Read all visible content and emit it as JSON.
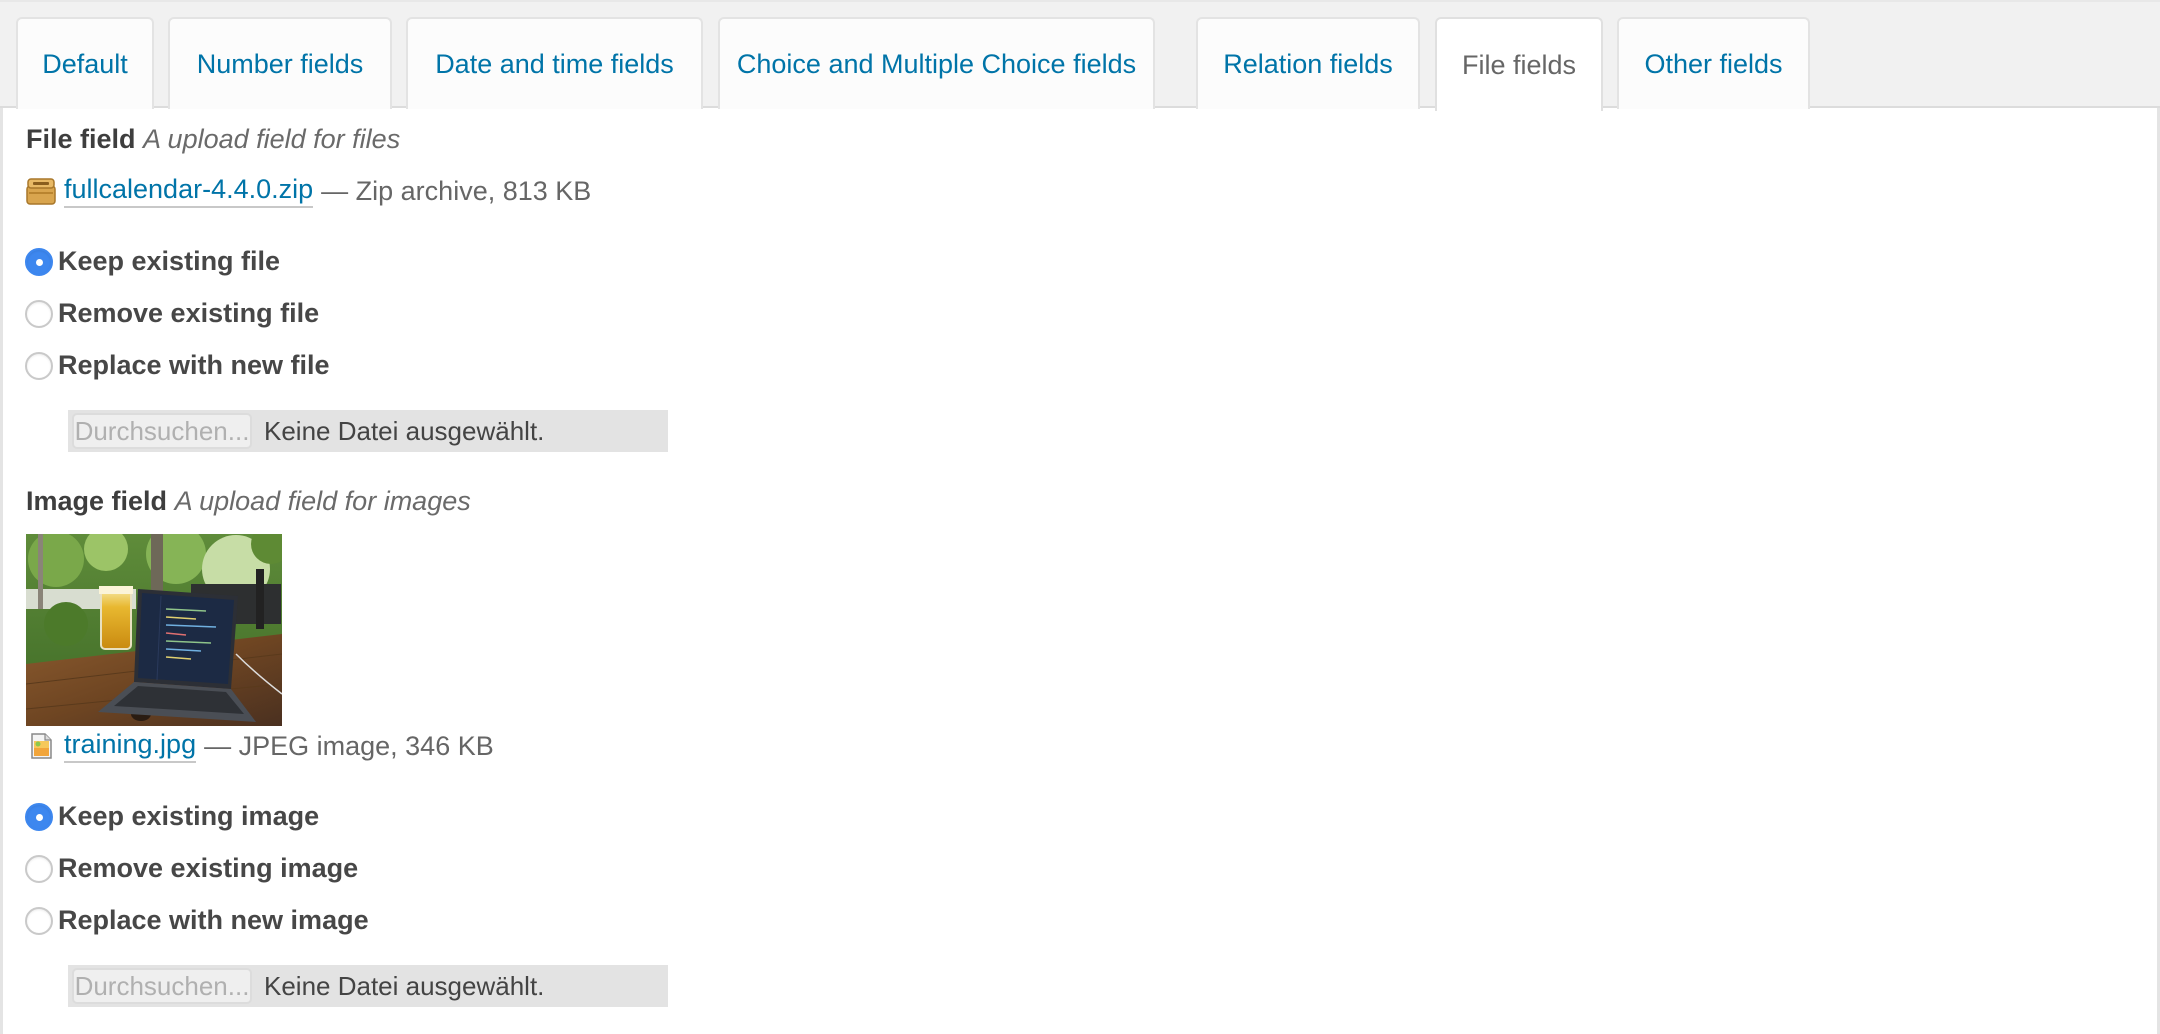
{
  "tabs": [
    {
      "label": "Default",
      "active": false
    },
    {
      "label": "Number fields",
      "active": false
    },
    {
      "label": "Date and time fields",
      "active": false
    },
    {
      "label": "Choice and Multiple Choice fields",
      "active": false
    },
    {
      "label": "Relation fields",
      "active": false
    },
    {
      "label": "File fields",
      "active": true
    },
    {
      "label": "Other fields",
      "active": false
    }
  ],
  "file_field": {
    "label": "File field",
    "help": "A upload field for files",
    "icon": "archive-icon",
    "filename": "fullcalendar-4.4.0.zip",
    "meta": "— Zip archive, 813 KB",
    "options": [
      {
        "label": "Keep existing file",
        "checked": true
      },
      {
        "label": "Remove existing file",
        "checked": false
      },
      {
        "label": "Replace with new file",
        "checked": false
      }
    ],
    "browse_label": "Durchsuchen...",
    "no_file_label": "Keine Datei ausgewählt."
  },
  "image_field": {
    "label": "Image field",
    "help": "A upload field for images",
    "thumbnail_alt": "Laptop on a wooden table next to a glass of beer in a garden",
    "icon": "image-file-icon",
    "filename": "training.jpg",
    "meta": "— JPEG image, 346 KB",
    "options": [
      {
        "label": "Keep existing image",
        "checked": true
      },
      {
        "label": "Remove existing image",
        "checked": false
      },
      {
        "label": "Replace with new image",
        "checked": false
      }
    ],
    "browse_label": "Durchsuchen...",
    "no_file_label": "Keine Datei ausgewählt."
  },
  "colors": {
    "link": "#0074a8",
    "radio_checked": "#3d87ef",
    "tab_bar_bg": "#f1f1f1"
  }
}
